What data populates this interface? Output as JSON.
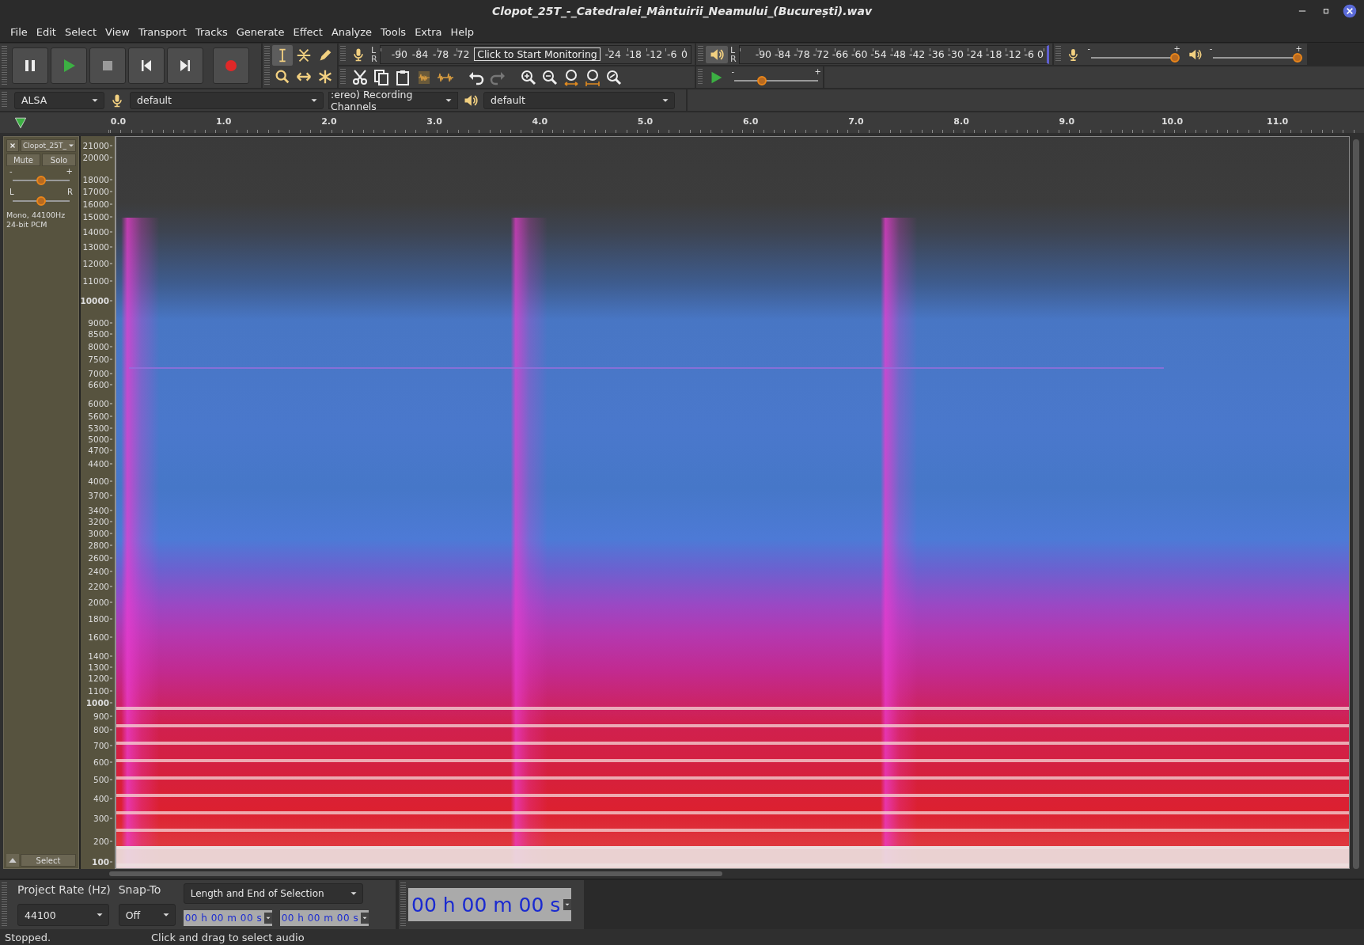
{
  "window": {
    "title": "Clopot_25T_-_Catedralei_Mântuirii_Neamului_(București).wav"
  },
  "menu": [
    "File",
    "Edit",
    "Select",
    "View",
    "Transport",
    "Tracks",
    "Generate",
    "Effect",
    "Analyze",
    "Tools",
    "Extra",
    "Help"
  ],
  "recording_meter": {
    "channels": [
      "L",
      "R"
    ],
    "scale_start": [
      "-90",
      "-84",
      "-78",
      "-72"
    ],
    "prompt": "Click to Start Monitoring",
    "scale_end": [
      "-24",
      "-18",
      "-12",
      "-6",
      "0"
    ]
  },
  "playback_meter": {
    "channels": [
      "L",
      "R"
    ],
    "scale": [
      "-90",
      "-84",
      "-78",
      "-72",
      "-66",
      "-60",
      "-54",
      "-48",
      "-42",
      "-36",
      "-30",
      "-24",
      "-18",
      "-12",
      "-6",
      "0"
    ]
  },
  "mixer": {
    "recording_volume": {
      "min": "-",
      "max": "+",
      "level": 0.97
    },
    "playback_volume": {
      "min": "-",
      "max": "+",
      "level": 0.98
    }
  },
  "play_at_speed": {
    "min": "-",
    "max": "+",
    "level": 0.33
  },
  "devices": {
    "host": "ALSA",
    "recording_device": "default",
    "recording_channels": ":ereo) Recording Channels",
    "playback_device": "default"
  },
  "timeline": {
    "ticks": [
      "0.0",
      "1.0",
      "2.0",
      "3.0",
      "4.0",
      "5.0",
      "6.0",
      "7.0",
      "8.0",
      "9.0",
      "10.0",
      "11.0"
    ]
  },
  "track": {
    "name": "Clopot_25T_",
    "mute": "Mute",
    "solo": "Solo",
    "gain": {
      "min": "-",
      "max": "+",
      "level": 0.5
    },
    "pan": {
      "min": "L",
      "max": "R",
      "level": 0.5
    },
    "info": "Mono, 44100Hz\n24-bit PCM",
    "select": "Select",
    "frequency_labels": [
      {
        "text": "21000",
        "bold": false
      },
      {
        "text": "20000",
        "bold": false
      },
      {
        "text": "18000",
        "bold": false
      },
      {
        "text": "17000",
        "bold": false
      },
      {
        "text": "16000",
        "bold": false
      },
      {
        "text": "15000",
        "bold": false
      },
      {
        "text": "14000",
        "bold": false
      },
      {
        "text": "13000",
        "bold": false
      },
      {
        "text": "12000",
        "bold": false
      },
      {
        "text": "11000",
        "bold": false
      },
      {
        "text": "10000",
        "bold": true
      },
      {
        "text": "9000",
        "bold": false
      },
      {
        "text": "8500",
        "bold": false
      },
      {
        "text": "8000",
        "bold": false
      },
      {
        "text": "7500",
        "bold": false
      },
      {
        "text": "7000",
        "bold": false
      },
      {
        "text": "6600",
        "bold": false
      },
      {
        "text": "6000",
        "bold": false
      },
      {
        "text": "5600",
        "bold": false
      },
      {
        "text": "5300",
        "bold": false
      },
      {
        "text": "5000",
        "bold": false
      },
      {
        "text": "4700",
        "bold": false
      },
      {
        "text": "4400",
        "bold": false
      },
      {
        "text": "4000",
        "bold": false
      },
      {
        "text": "3700",
        "bold": false
      },
      {
        "text": "3400",
        "bold": false
      },
      {
        "text": "3200",
        "bold": false
      },
      {
        "text": "3000",
        "bold": false
      },
      {
        "text": "2800",
        "bold": false
      },
      {
        "text": "2600",
        "bold": false
      },
      {
        "text": "2400",
        "bold": false
      },
      {
        "text": "2200",
        "bold": false
      },
      {
        "text": "2000",
        "bold": false
      },
      {
        "text": "1800",
        "bold": false
      },
      {
        "text": "1600",
        "bold": false
      },
      {
        "text": "1400",
        "bold": false
      },
      {
        "text": "1300",
        "bold": false
      },
      {
        "text": "1200",
        "bold": false
      },
      {
        "text": "1100",
        "bold": false
      },
      {
        "text": "1000",
        "bold": true
      },
      {
        "text": "900",
        "bold": false
      },
      {
        "text": "800",
        "bold": false
      },
      {
        "text": "700",
        "bold": false
      },
      {
        "text": "600",
        "bold": false
      },
      {
        "text": "500",
        "bold": false
      },
      {
        "text": "400",
        "bold": false
      },
      {
        "text": "300",
        "bold": false
      },
      {
        "text": "200",
        "bold": false
      },
      {
        "text": "100",
        "bold": true
      }
    ]
  },
  "selection_toolbar": {
    "project_rate_label": "Project Rate (Hz)",
    "project_rate": "44100",
    "snap_label": "Snap-To",
    "snap": "Off",
    "selection_mode": "Length and End of Selection",
    "length": "00 h 00 m 00 s",
    "end": "00 h 00 m 00 s"
  },
  "time_display": "00 h 00 m 00 s",
  "status_bar": {
    "state": "Stopped.",
    "hint": "Click and drag to select audio"
  }
}
